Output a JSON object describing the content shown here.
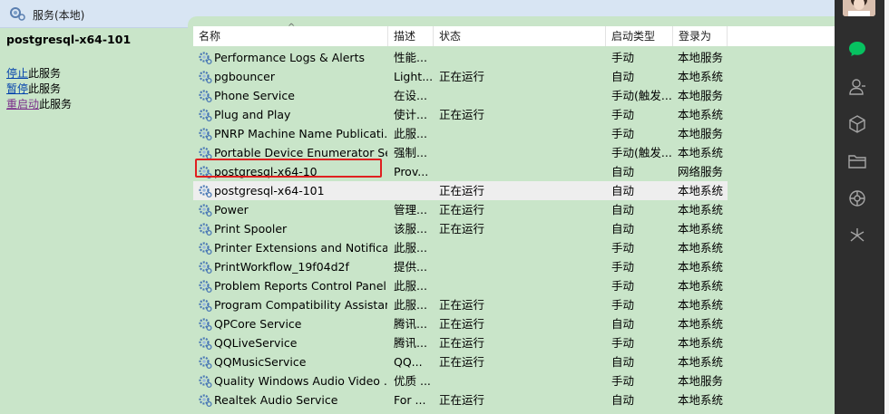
{
  "window": {
    "title": "服务(本地)"
  },
  "left_pane": {
    "service_name": "postgresql-x64-101",
    "actions": [
      {
        "link": "停止",
        "suffix": "此服务"
      },
      {
        "link": "暂停",
        "suffix": "此服务"
      },
      {
        "link": "重启动",
        "suffix": "此服务"
      }
    ]
  },
  "columns": [
    "名称",
    "描述",
    "状态",
    "启动类型",
    "登录为"
  ],
  "services": [
    {
      "name": "Performance Logs & Alerts",
      "desc": "性能...",
      "status": "",
      "startup": "手动",
      "logon": "本地服务"
    },
    {
      "name": "pgbouncer",
      "desc": "Light...",
      "status": "正在运行",
      "startup": "自动",
      "logon": "本地系统"
    },
    {
      "name": "Phone Service",
      "desc": "在设...",
      "status": "",
      "startup": "手动(触发...",
      "logon": "本地服务"
    },
    {
      "name": "Plug and Play",
      "desc": "使计...",
      "status": "正在运行",
      "startup": "手动",
      "logon": "本地系统"
    },
    {
      "name": "PNRP Machine Name Publicati...",
      "desc": "此服...",
      "status": "",
      "startup": "手动",
      "logon": "本地服务"
    },
    {
      "name": "Portable Device Enumerator Se...",
      "desc": "强制...",
      "status": "",
      "startup": "手动(触发...",
      "logon": "本地系统"
    },
    {
      "name": "postgresql-x64-10",
      "desc": "Prov...",
      "status": "",
      "startup": "自动",
      "logon": "网络服务"
    },
    {
      "name": "postgresql-x64-101",
      "desc": "",
      "status": "正在运行",
      "startup": "自动",
      "logon": "本地系统"
    },
    {
      "name": "Power",
      "desc": "管理...",
      "status": "正在运行",
      "startup": "自动",
      "logon": "本地系统"
    },
    {
      "name": "Print Spooler",
      "desc": "该服...",
      "status": "正在运行",
      "startup": "自动",
      "logon": "本地系统"
    },
    {
      "name": "Printer Extensions and Notificat...",
      "desc": "此服...",
      "status": "",
      "startup": "手动",
      "logon": "本地系统"
    },
    {
      "name": "PrintWorkflow_19f04d2f",
      "desc": "提供...",
      "status": "",
      "startup": "手动",
      "logon": "本地系统"
    },
    {
      "name": "Problem Reports Control Panel...",
      "desc": "此服...",
      "status": "",
      "startup": "手动",
      "logon": "本地系统"
    },
    {
      "name": "Program Compatibility Assistan...",
      "desc": "此服...",
      "status": "正在运行",
      "startup": "手动",
      "logon": "本地系统"
    },
    {
      "name": "QPCore Service",
      "desc": "腾讯...",
      "status": "正在运行",
      "startup": "自动",
      "logon": "本地系统"
    },
    {
      "name": "QQLiveService",
      "desc": "腾讯...",
      "status": "正在运行",
      "startup": "手动",
      "logon": "本地系统"
    },
    {
      "name": "QQMusicService",
      "desc": "QQ...",
      "status": "正在运行",
      "startup": "自动",
      "logon": "本地系统"
    },
    {
      "name": "Quality Windows Audio Video ...",
      "desc": "优质 ...",
      "status": "",
      "startup": "手动",
      "logon": "本地服务"
    },
    {
      "name": "Realtek Audio Service",
      "desc": "For ...",
      "status": "正在运行",
      "startup": "自动",
      "logon": "本地系统"
    }
  ],
  "selected_service": "postgresql-x64-101",
  "highlighted_service": "postgresql-x64-10",
  "colors": {
    "background": "#c9e5c9",
    "highlight_border": "#e02020",
    "sidebar": "#2e2e2e",
    "chat_accent": "#07c160"
  },
  "sidebar_icons": [
    "chat-icon",
    "contacts-icon",
    "cube-icon",
    "folder-icon",
    "moments-icon",
    "sparkle-icon"
  ]
}
